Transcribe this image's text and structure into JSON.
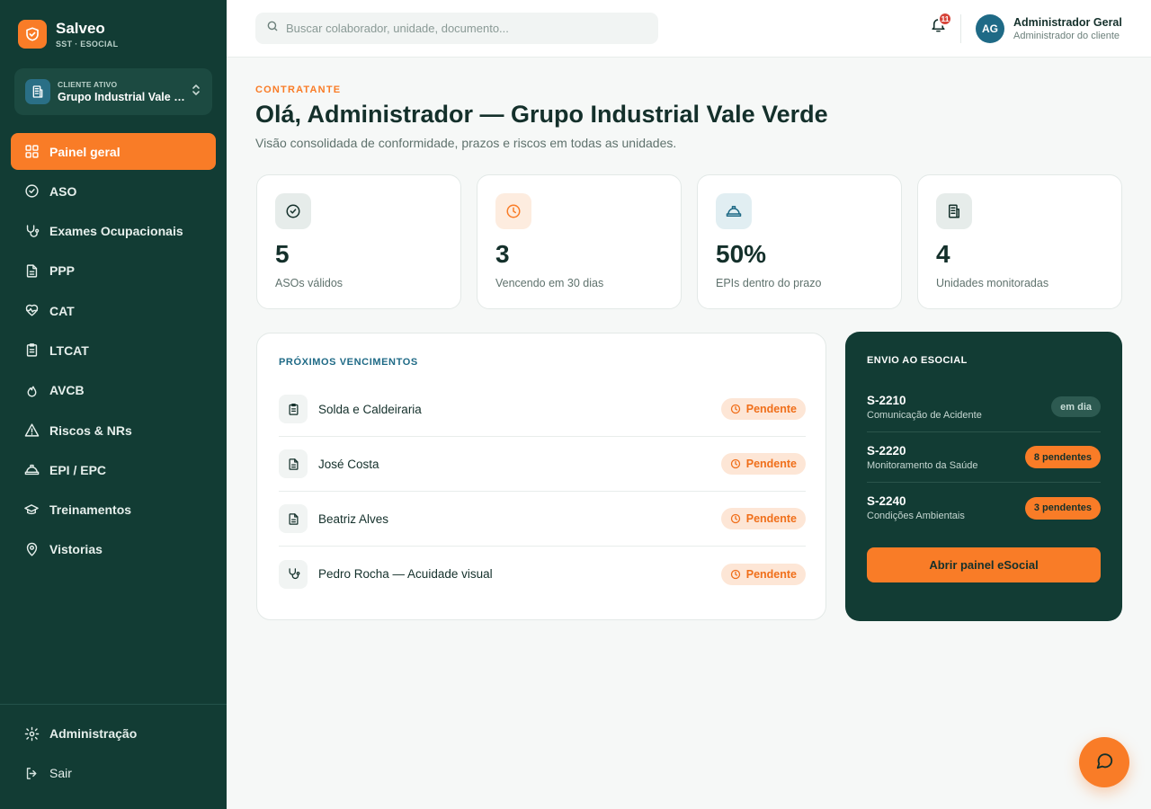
{
  "brand": {
    "name": "Salveo",
    "subtitle": "SST · ESOCIAL"
  },
  "client": {
    "label": "CLIENTE ATIVO",
    "name": "Grupo Industrial Vale Verde"
  },
  "sidebar": {
    "items": [
      {
        "label": "Painel geral",
        "icon": "grid-icon",
        "active": true
      },
      {
        "label": "ASO",
        "icon": "check-circle-icon"
      },
      {
        "label": "Exames Ocupacionais",
        "icon": "stethoscope-icon"
      },
      {
        "label": "PPP",
        "icon": "document-icon"
      },
      {
        "label": "CAT",
        "icon": "heart-pulse-icon"
      },
      {
        "label": "LTCAT",
        "icon": "clipboard-icon"
      },
      {
        "label": "AVCB",
        "icon": "flame-icon"
      },
      {
        "label": "Riscos & NRs",
        "icon": "warning-icon"
      },
      {
        "label": "EPI / EPC",
        "icon": "hard-hat-icon"
      },
      {
        "label": "Treinamentos",
        "icon": "graduation-cap-icon"
      },
      {
        "label": "Vistorias",
        "icon": "map-pin-icon"
      }
    ],
    "bottom": [
      {
        "label": "Administração",
        "icon": "gear-icon"
      },
      {
        "label": "Sair",
        "icon": "logout-icon"
      }
    ]
  },
  "topbar": {
    "search_placeholder": "Buscar colaborador, unidade, documento...",
    "notifications_count": "11",
    "user": {
      "initials": "AG",
      "name": "Administrador Geral",
      "role": "Administrador do cliente"
    }
  },
  "main": {
    "eyebrow": "CONTRATANTE",
    "title": "Olá, Administrador — Grupo Industrial Vale Verde",
    "subtitle": "Visão consolidada de conformidade, prazos e riscos em todas as unidades.",
    "stats": [
      {
        "value": "5",
        "label": "ASOs válidos",
        "icon": "check-circle-icon"
      },
      {
        "value": "3",
        "label": "Vencendo em 30 dias",
        "icon": "clock-icon"
      },
      {
        "value": "50%",
        "label": "EPIs dentro do prazo",
        "icon": "hard-hat-icon"
      },
      {
        "value": "4",
        "label": "Unidades monitoradas",
        "icon": "building-icon"
      }
    ],
    "deadlines": {
      "title": "PRÓXIMOS VENCIMENTOS",
      "items": [
        {
          "label": "Solda e Caldeiraria",
          "status": "Pendente",
          "icon": "clipboard-icon"
        },
        {
          "label": "José Costa",
          "status": "Pendente",
          "icon": "document-icon"
        },
        {
          "label": "Beatriz Alves",
          "status": "Pendente",
          "icon": "document-icon"
        },
        {
          "label": "Pedro Rocha — Acuidade visual",
          "status": "Pendente",
          "icon": "stethoscope-icon"
        }
      ]
    },
    "esocial": {
      "title": "ENVIO AO ESOCIAL",
      "events": [
        {
          "code": "S-2210",
          "desc": "Comunicação de Acidente",
          "badge": "em dia"
        },
        {
          "code": "S-2220",
          "desc": "Monitoramento da Saúde",
          "badge": "8 pendentes"
        },
        {
          "code": "S-2240",
          "desc": "Condições Ambientais",
          "badge": "3 pendentes"
        }
      ],
      "button": "Abrir painel eSocial"
    }
  },
  "colors": {
    "sidebar": "#123c34",
    "accent": "#f97c27",
    "primary_text": "#14302b",
    "teal": "#1f6a86"
  }
}
